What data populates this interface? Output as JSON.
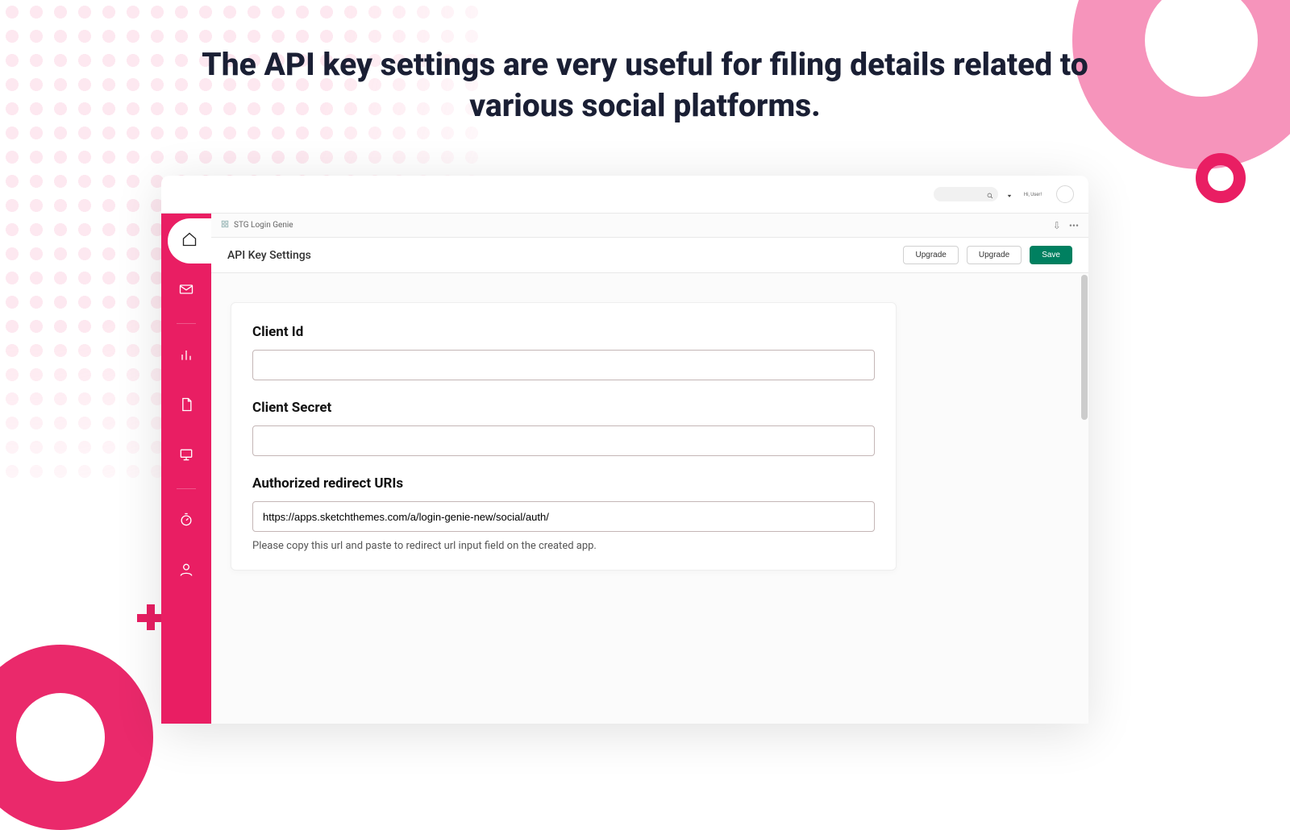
{
  "headline": "The API key settings are very useful for filing details related to various social platforms.",
  "topbar": {
    "user_greeting": "Hi, User!"
  },
  "crumb": {
    "app_name": "STG Login Genie",
    "pin_glyph": "⇩",
    "more_glyph": "•••"
  },
  "page": {
    "title": "API Key Settings",
    "upgrade_secondary": "Upgrade",
    "upgrade_primary": "Upgrade",
    "save": "Save"
  },
  "form": {
    "client_id_label": "Client Id",
    "client_id_value": "",
    "client_secret_label": "Client Secret",
    "client_secret_value": "",
    "redirect_label": "Authorized redirect URIs",
    "redirect_value": "https://apps.sketchthemes.com/a/login-genie-new/social/auth/",
    "redirect_helper": "Please copy this url and paste to redirect url input field on the created app."
  },
  "sidebar": {
    "items": [
      {
        "name": "home"
      },
      {
        "name": "orders"
      },
      {
        "name": "analytics"
      },
      {
        "name": "content"
      },
      {
        "name": "online-store"
      },
      {
        "name": "discounts"
      },
      {
        "name": "customers"
      }
    ]
  }
}
